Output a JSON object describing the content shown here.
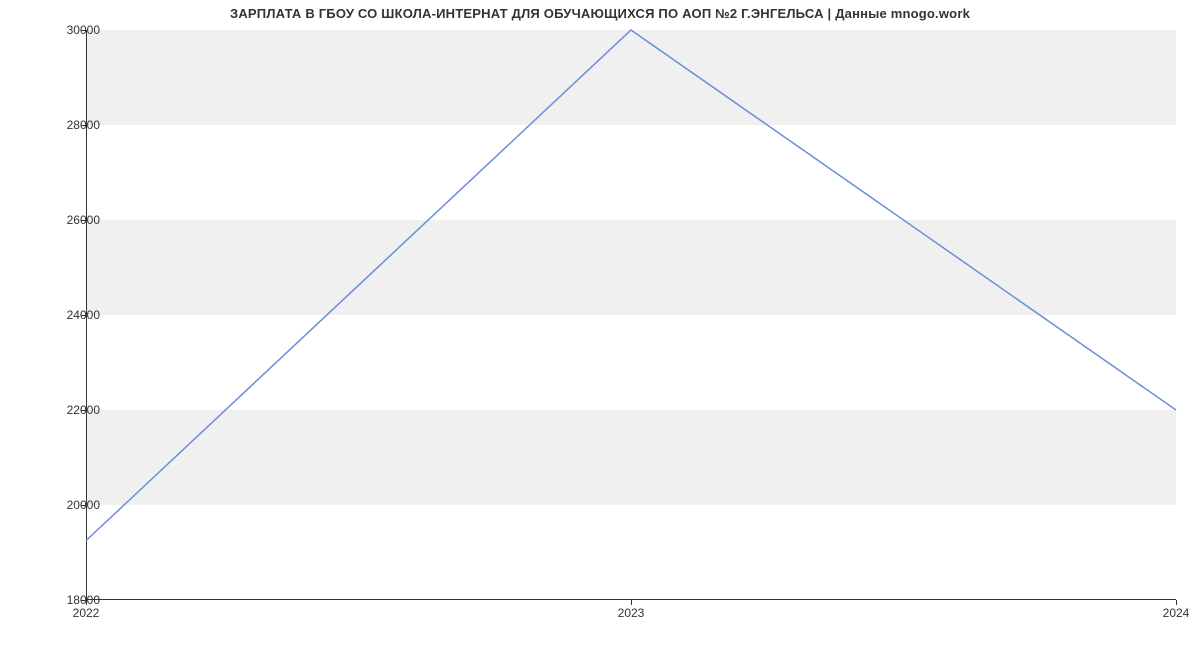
{
  "chart_data": {
    "type": "line",
    "title": "ЗАРПЛАТА В ГБОУ СО ШКОЛА-ИНТЕРНАТ ДЛЯ ОБУЧАЮЩИХСЯ ПО АОП №2 Г.ЭНГЕЛЬСА | Данные mnogo.work",
    "x": [
      2022,
      2023,
      2024
    ],
    "values": [
      19250,
      30000,
      22000
    ],
    "xlabel": "",
    "ylabel": "",
    "ylim": [
      18000,
      30000
    ],
    "y_ticks": [
      18000,
      20000,
      22000,
      24000,
      26000,
      28000,
      30000
    ],
    "x_ticks": [
      2022,
      2023,
      2024
    ],
    "line_color": "#6a8fd8",
    "band_color": "#f0f0f0"
  }
}
